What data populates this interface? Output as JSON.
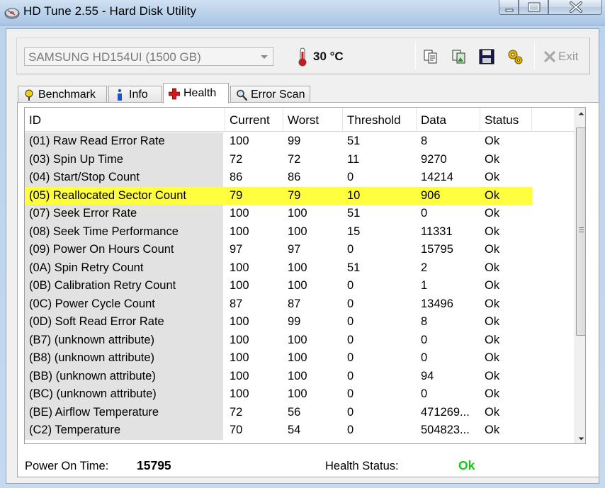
{
  "window": {
    "title": "HD Tune 2.55 - Hard Disk Utility",
    "icons": {
      "app": "hdtune-disk-icon",
      "minimize": "minimize-icon",
      "maximize": "maximize-icon",
      "close": "close-icon"
    }
  },
  "toolbar": {
    "drive": "SAMSUNG HD154UI (1500 GB)",
    "temperature": "30 °C",
    "temperature_icon": "thermometer-icon",
    "buttons": [
      "copy-text-icon",
      "copy-screenshot-icon",
      "save-icon",
      "options-icon"
    ],
    "exit_label": "Exit"
  },
  "tabs": [
    {
      "label": "Benchmark",
      "icon": "gauge-icon"
    },
    {
      "label": "Info",
      "icon": "info-icon"
    },
    {
      "label": "Health",
      "icon": "health-cross-icon",
      "active": true
    },
    {
      "label": "Error Scan",
      "icon": "magnifier-icon"
    }
  ],
  "health": {
    "columns": [
      "ID",
      "Current",
      "Worst",
      "Threshold",
      "Data",
      "Status"
    ],
    "rows": [
      {
        "id": "(01) Raw Read Error Rate",
        "current": "100",
        "worst": "99",
        "threshold": "51",
        "data": "8",
        "status": "Ok"
      },
      {
        "id": "(03) Spin Up Time",
        "current": "72",
        "worst": "72",
        "threshold": "11",
        "data": "9270",
        "status": "Ok"
      },
      {
        "id": "(04) Start/Stop Count",
        "current": "86",
        "worst": "86",
        "threshold": "0",
        "data": "14214",
        "status": "Ok"
      },
      {
        "id": "(05) Reallocated Sector Count",
        "current": "79",
        "worst": "79",
        "threshold": "10",
        "data": "906",
        "status": "Ok",
        "highlight": true
      },
      {
        "id": "(07) Seek Error Rate",
        "current": "100",
        "worst": "100",
        "threshold": "51",
        "data": "0",
        "status": "Ok"
      },
      {
        "id": "(08) Seek Time Performance",
        "current": "100",
        "worst": "100",
        "threshold": "15",
        "data": "11331",
        "status": "Ok"
      },
      {
        "id": "(09) Power On Hours Count",
        "current": "97",
        "worst": "97",
        "threshold": "0",
        "data": "15795",
        "status": "Ok"
      },
      {
        "id": "(0A) Spin Retry Count",
        "current": "100",
        "worst": "100",
        "threshold": "51",
        "data": "2",
        "status": "Ok"
      },
      {
        "id": "(0B) Calibration Retry Count",
        "current": "100",
        "worst": "100",
        "threshold": "0",
        "data": "1",
        "status": "Ok"
      },
      {
        "id": "(0C) Power Cycle Count",
        "current": "87",
        "worst": "87",
        "threshold": "0",
        "data": "13496",
        "status": "Ok"
      },
      {
        "id": "(0D) Soft Read Error Rate",
        "current": "100",
        "worst": "99",
        "threshold": "0",
        "data": "8",
        "status": "Ok"
      },
      {
        "id": "(B7) (unknown attribute)",
        "current": "100",
        "worst": "100",
        "threshold": "0",
        "data": "0",
        "status": "Ok"
      },
      {
        "id": "(B8) (unknown attribute)",
        "current": "100",
        "worst": "100",
        "threshold": "0",
        "data": "0",
        "status": "Ok"
      },
      {
        "id": "(BB) (unknown attribute)",
        "current": "100",
        "worst": "100",
        "threshold": "0",
        "data": "94",
        "status": "Ok"
      },
      {
        "id": "(BC) (unknown attribute)",
        "current": "100",
        "worst": "100",
        "threshold": "0",
        "data": "0",
        "status": "Ok"
      },
      {
        "id": "(BE) Airflow Temperature",
        "current": "72",
        "worst": "56",
        "threshold": "0",
        "data": "471269...",
        "status": "Ok"
      },
      {
        "id": "(C2) Temperature",
        "current": "70",
        "worst": "54",
        "threshold": "0",
        "data": "504823...",
        "status": "Ok"
      }
    ],
    "highlight_color": "#ffff40"
  },
  "footer": {
    "power_on_label": "Power On Time:",
    "power_on_value": "15795",
    "health_status_label": "Health Status:",
    "health_status_value": "Ok",
    "health_status_color": "#18c418"
  }
}
